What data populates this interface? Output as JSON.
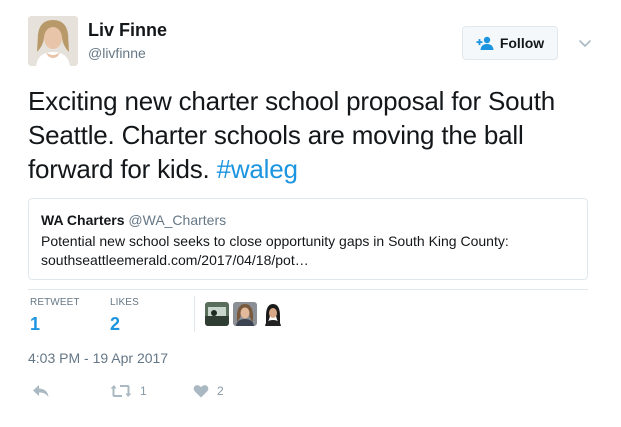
{
  "author": {
    "name": "Liv Finne",
    "handle": "@livfinne"
  },
  "follow_button": {
    "label": "Follow",
    "icon": "add-user-icon"
  },
  "tweet": {
    "text": "Exciting new charter school proposal for South Seattle. Charter schools are moving the ball forward for kids. ",
    "hashtag": "#waleg"
  },
  "quoted_tweet": {
    "name": "WA Charters",
    "handle": "@WA_Charters",
    "text": "Potential new school seeks to close opportunity gaps in South King County:",
    "link": "southseattleemerald.com/2017/04/18/pot…"
  },
  "stats": {
    "retweets_label": "RETWEET",
    "retweets_value": "1",
    "likes_label": "LIKES",
    "likes_value": "2"
  },
  "timestamp": "4:03 PM - 19 Apr 2017",
  "actions": {
    "reply_icon": "reply-icon",
    "retweet_icon": "retweet-icon",
    "retweet_count": "1",
    "like_icon": "heart-icon",
    "like_count": "2"
  },
  "colors": {
    "link": "#1b95e0",
    "muted": "#657786",
    "border": "#e1e8ed",
    "text": "#14171a"
  }
}
